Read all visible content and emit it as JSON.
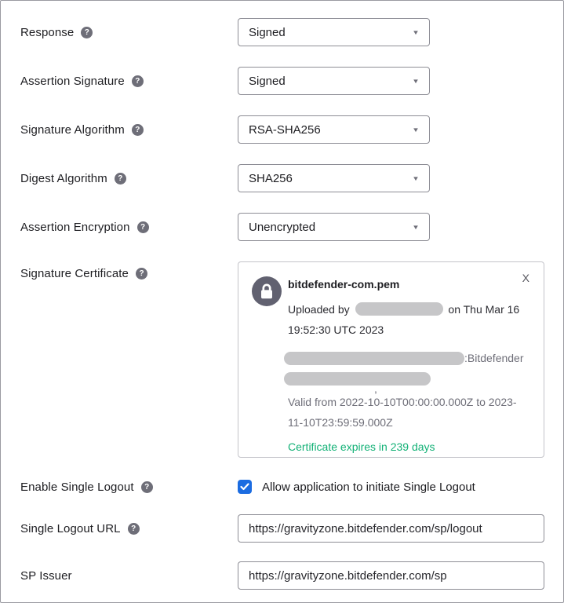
{
  "form": {
    "response": {
      "label": "Response",
      "value": "Signed"
    },
    "assertion_signature": {
      "label": "Assertion Signature",
      "value": "Signed"
    },
    "signature_algorithm": {
      "label": "Signature Algorithm",
      "value": "RSA-SHA256"
    },
    "digest_algorithm": {
      "label": "Digest Algorithm",
      "value": "SHA256"
    },
    "assertion_encryption": {
      "label": "Assertion Encryption",
      "value": "Unencrypted"
    },
    "signature_certificate": {
      "label": "Signature Certificate",
      "certificate": {
        "filename": "bitdefender-com.pem",
        "uploaded_prefix": "Uploaded by",
        "uploaded_suffix": "on Thu Mar 16 19:52:30 UTC 2023",
        "issuer_suffix": ":Bitdefender",
        "subject_artifact": ",",
        "validity": "Valid from 2022-10-10T00:00:00.000Z to 2023-11-10T23:59:59.000Z",
        "expiry_notice": "Certificate expires in 239 days",
        "close_label": "X"
      }
    },
    "enable_single_logout": {
      "label": "Enable Single Logout",
      "checkbox_label": "Allow application to initiate Single Logout",
      "checked": true
    },
    "single_logout_url": {
      "label": "Single Logout URL",
      "value": "https://gravityzone.bitdefender.com/sp/logout"
    },
    "sp_issuer": {
      "label": "SP Issuer",
      "value": "https://gravityzone.bitdefender.com/sp"
    }
  },
  "icons": {
    "help": "?",
    "dropdown_arrow": "▼"
  },
  "colors": {
    "checkbox_blue": "#1b6ce1",
    "expiry_green": "#12b176",
    "redaction_gray": "#c6c6c8",
    "lock_circle_gray": "#616170",
    "border_gray": "#8d8d95"
  }
}
